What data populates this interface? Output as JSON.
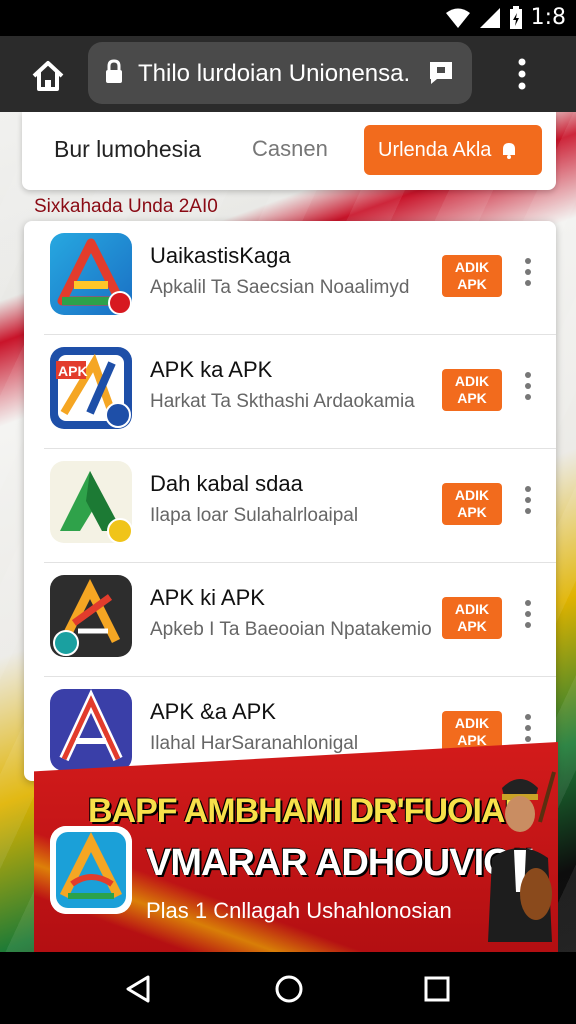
{
  "status_bar": {
    "time": "1:8",
    "icons": [
      "wifi-icon",
      "signal-icon",
      "battery-icon"
    ]
  },
  "browser": {
    "url": "Thilo lurdoian Unionensa.",
    "icons": [
      "home-icon",
      "lock-icon",
      "chat-icon",
      "more-vert-icon"
    ]
  },
  "search": {
    "label": "Bur lumohesia",
    "secondary": "Casnen",
    "button_label": "Urlenda Akla"
  },
  "section_label": "Sixkahada Unda 2AI0",
  "apps": [
    {
      "title": "UaikastisKaga",
      "subtitle": "Apkalil Ta Saecsian Noaalimyd",
      "button": [
        "ADIK",
        "APK"
      ],
      "icon": "triangle-a-icon"
    },
    {
      "title": "APK ka APK",
      "subtitle": "Harkat Ta Skthashi Ardaokamia",
      "button": [
        "ADIK",
        "APK"
      ],
      "icon": "apk-a-icon"
    },
    {
      "title": "Dah kabal sdaa",
      "subtitle": "Ilapa loar Sulahalrloaipal",
      "button": [
        "ADIK",
        "APK"
      ],
      "icon": "green-a-icon"
    },
    {
      "title": "APK ki APK",
      "subtitle": "Apkeb I Ta Baeooian Npatakemio",
      "button": [
        "ADIK",
        "APK"
      ],
      "icon": "dark-a-icon"
    },
    {
      "title": "APK &a APK",
      "subtitle": "Ilahal HarSaranahlonigal",
      "button": [
        "ADIK",
        "APK"
      ],
      "icon": "purple-a-icon"
    }
  ],
  "banner": {
    "line1": "BAPF AMBHAMI DR'FUOIAN",
    "line2": "VMARAR ADHOUVIQ!!",
    "line3": "Plas 1 Cnllagah Ushahlonosian"
  },
  "colors": {
    "accent": "#f26b1d",
    "banner_red": "#d31b1b",
    "toolbar": "#2b2b2b"
  },
  "nav": {
    "icons": [
      "back-icon",
      "home-circle-icon",
      "recent-apps-icon"
    ]
  }
}
